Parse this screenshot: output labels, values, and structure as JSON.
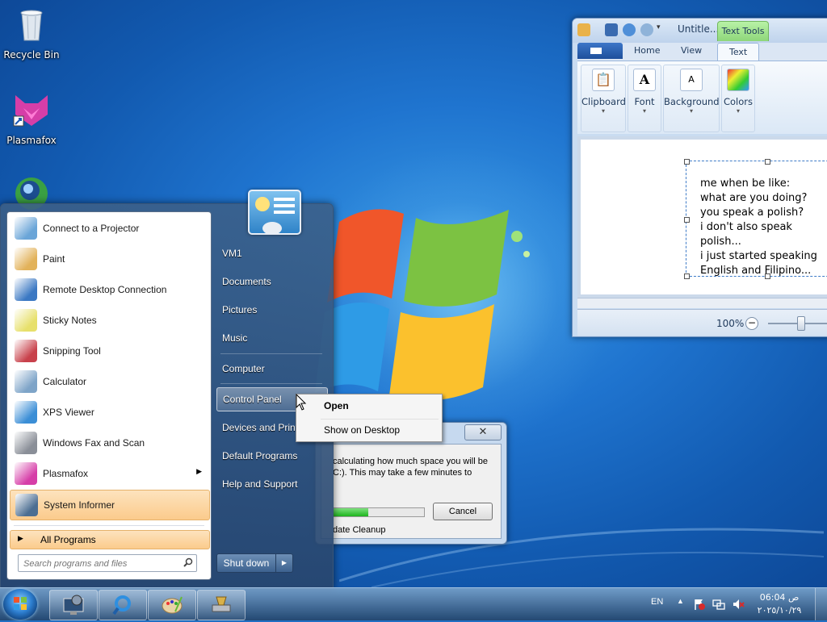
{
  "desktop": {
    "icons": [
      {
        "label": "Recycle Bin",
        "icon": "recycle-bin-icon"
      },
      {
        "label": "Plasmafox",
        "icon": "plasmafox-icon"
      },
      {
        "label": "",
        "icon": "network-globe-icon"
      }
    ]
  },
  "paint": {
    "title": "Untitle...",
    "context_tab": "Text Tools",
    "tabs": [
      "Home",
      "View",
      "Text"
    ],
    "selected_tab": "Text",
    "groups": [
      {
        "label": "Clipboard",
        "icon": "clipboard-icon"
      },
      {
        "label": "Font",
        "icon": "font-icon"
      },
      {
        "label": "Background",
        "icon": "background-icon"
      },
      {
        "label": "Colors",
        "icon": "colors-icon"
      }
    ],
    "canvas_lines": [
      "me when be like:",
      "what are you doing?",
      "you speak a polish?",
      "i don't also speak",
      "polish...",
      "i just started speaking",
      "English and Filipino..."
    ],
    "zoom": "100%",
    "zoom_minus": "−"
  },
  "cleanup": {
    "close": "✕",
    "message": "calculating how much space you will be ... C:). This may take a few minutes to",
    "message_line1": "calculating how much space you will be",
    "message_line2": "C:). This may take a few minutes to",
    "progress": 0.38,
    "cancel": "Cancel",
    "footer": "date Cleanup"
  },
  "start_menu": {
    "programs": [
      {
        "label": "Connect to a Projector",
        "icon": "projector-icon",
        "color": "#6aa5d8"
      },
      {
        "label": "Paint",
        "icon": "paint-palette-icon",
        "color": "#e2b25a"
      },
      {
        "label": "Remote Desktop Connection",
        "icon": "remote-desktop-icon",
        "color": "#3b78c3"
      },
      {
        "label": "Sticky Notes",
        "icon": "sticky-notes-icon",
        "color": "#e7e06b"
      },
      {
        "label": "Snipping Tool",
        "icon": "scissors-icon",
        "color": "#c8414b"
      },
      {
        "label": "Calculator",
        "icon": "calculator-icon",
        "color": "#7ea4c8"
      },
      {
        "label": "XPS Viewer",
        "icon": "xps-viewer-icon",
        "color": "#3b8ed6"
      },
      {
        "label": "Windows Fax and Scan",
        "icon": "fax-scanner-icon",
        "color": "#8a8f98"
      },
      {
        "label": "Plasmafox",
        "icon": "plasmafox-icon",
        "color": "#d63ea8",
        "submenu": "▶"
      },
      {
        "label": "System Informer",
        "icon": "system-informer-icon",
        "color": "#4c6e92"
      }
    ],
    "all_programs": "All Programs",
    "all_programs_arrow": "▶",
    "search_placeholder": "Search programs and files",
    "right_items": [
      "VM1",
      "Documents",
      "Pictures",
      "Music",
      "Computer",
      "Control Panel",
      "Devices and Print",
      "Default Programs",
      "Help and Support"
    ],
    "shutdown": "Shut down",
    "shutdown_arrow": "▶"
  },
  "context_menu": {
    "items": [
      "Open",
      "Show on Desktop"
    ]
  },
  "taskbar": {
    "language": "EN",
    "time": "06:04 ص",
    "date": "٢٠٢٥/١٠/٢٩"
  }
}
